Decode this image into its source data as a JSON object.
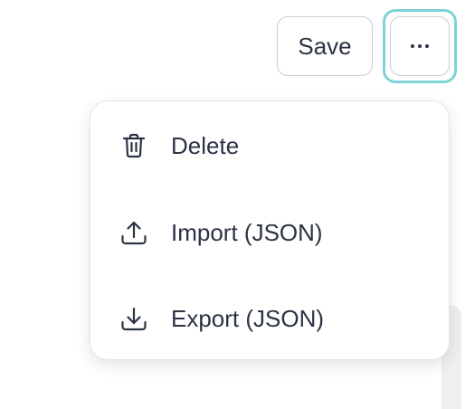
{
  "toolbar": {
    "save_label": "Save",
    "more_icon": "ellipsis-horizontal-icon"
  },
  "menu": {
    "items": [
      {
        "label": "Delete",
        "icon": "trash-icon"
      },
      {
        "label": "Import (JSON)",
        "icon": "upload-icon"
      },
      {
        "label": "Export (JSON)",
        "icon": "download-icon"
      }
    ]
  },
  "colors": {
    "text": "#2c3344",
    "border": "#c9ccd2",
    "focus_ring": "#7ed3d8",
    "background": "#ffffff"
  }
}
